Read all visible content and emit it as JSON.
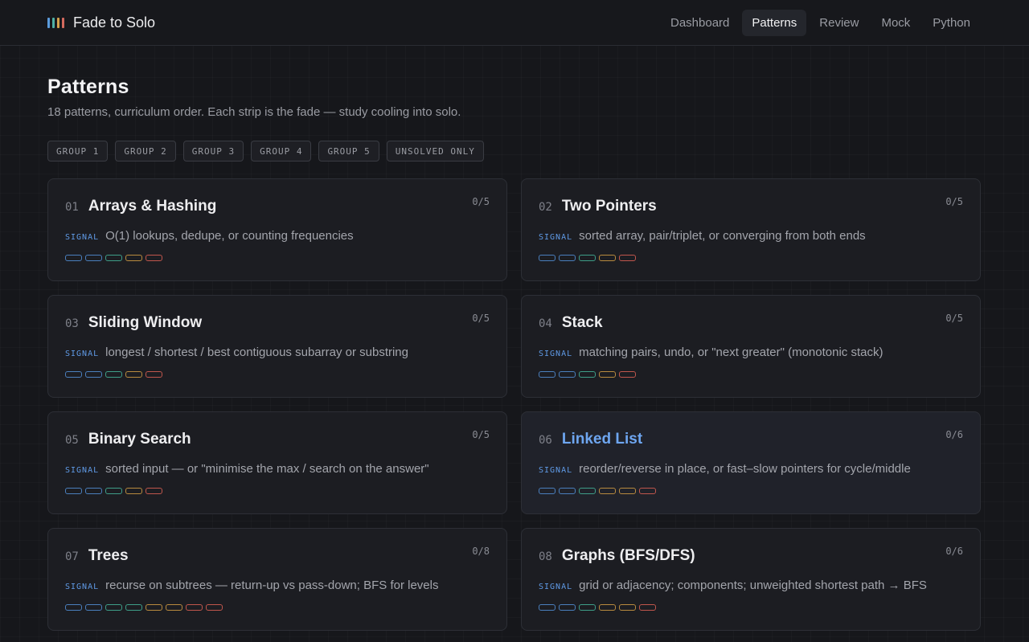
{
  "app": {
    "name": "Fade to Solo",
    "logo_colors": [
      "#5b9bdc",
      "#4fb0a4",
      "#d4a24c",
      "#d46a5e"
    ]
  },
  "nav": {
    "items": [
      {
        "label": "Dashboard",
        "active": false
      },
      {
        "label": "Patterns",
        "active": true
      },
      {
        "label": "Review",
        "active": false
      },
      {
        "label": "Mock",
        "active": false
      },
      {
        "label": "Python",
        "active": false
      }
    ]
  },
  "page": {
    "title": "Patterns",
    "subtitle": "18 patterns, curriculum order. Each strip is the fade — study cooling into solo."
  },
  "filters": [
    "GROUP 1",
    "GROUP 2",
    "GROUP 3",
    "GROUP 4",
    "GROUP 5",
    "UNSOLVED ONLY"
  ],
  "signal_label": "SIGNAL",
  "strip_colors": [
    "#4a7fbd",
    "#4a7fbd",
    "#3e9e88",
    "#b88a3e",
    "#c0564c"
  ],
  "strip_colors_6": [
    "#4a7fbd",
    "#4a7fbd",
    "#3e9e88",
    "#b88a3e",
    "#b88a3e",
    "#c0564c"
  ],
  "strip_colors_8": [
    "#4a7fbd",
    "#4a7fbd",
    "#3e9e88",
    "#3e9e88",
    "#b88a3e",
    "#b88a3e",
    "#c0564c",
    "#c0564c"
  ],
  "patterns": [
    {
      "num": "01",
      "title": "Arrays & Hashing",
      "progress": "0/5",
      "signal": "O(1) lookups, dedupe, or counting frequencies",
      "strips": 5
    },
    {
      "num": "02",
      "title": "Two Pointers",
      "progress": "0/5",
      "signal": "sorted array, pair/triplet, or converging from both ends",
      "strips": 5
    },
    {
      "num": "03",
      "title": "Sliding Window",
      "progress": "0/5",
      "signal": "longest / shortest / best contiguous subarray or substring",
      "strips": 5
    },
    {
      "num": "04",
      "title": "Stack",
      "progress": "0/5",
      "signal": "matching pairs, undo, or \"next greater\" (monotonic stack)",
      "strips": 5
    },
    {
      "num": "05",
      "title": "Binary Search",
      "progress": "0/5",
      "signal": "sorted input — or \"minimise the max / search on the answer\"",
      "strips": 5
    },
    {
      "num": "06",
      "title": "Linked List",
      "progress": "0/6",
      "signal": "reorder/reverse in place, or fast–slow pointers for cycle/middle",
      "strips": 6,
      "highlight": true
    },
    {
      "num": "07",
      "title": "Trees",
      "progress": "0/8",
      "signal": "recurse on subtrees — return-up vs pass-down; BFS for levels",
      "strips": 8
    },
    {
      "num": "08",
      "title": "Graphs (BFS/DFS)",
      "progress": "0/6",
      "signal": "grid or adjacency; components; unweighted shortest path → BFS",
      "strips": 6
    }
  ]
}
